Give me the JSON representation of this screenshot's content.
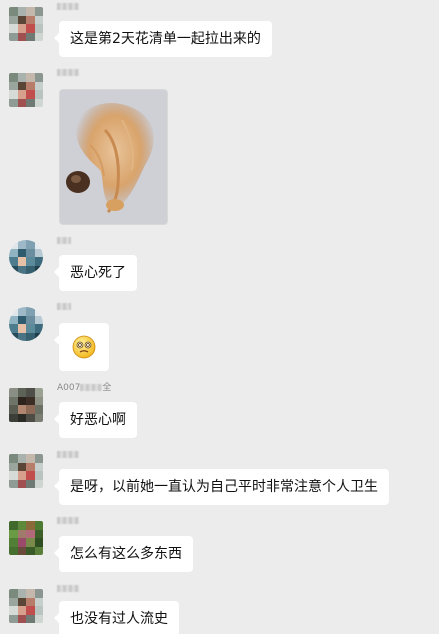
{
  "messages": [
    {
      "id": "m1",
      "sender_visible": "",
      "text": "这是第2天花清单一起拉出来的"
    },
    {
      "id": "m2",
      "sender_visible": "",
      "image_icon": "photo-image"
    },
    {
      "id": "m3",
      "sender_visible": "",
      "text": "恶心死了"
    },
    {
      "id": "m4",
      "sender_visible": "",
      "emoji_icon": "dizzy-face-emoji"
    },
    {
      "id": "m5",
      "sender_prefix": "A007",
      "sender_suffix": "全",
      "text": "好恶心啊"
    },
    {
      "id": "m6",
      "sender_visible": "",
      "text": "是呀，以前她一直认为自己平时非常注意个人卫生"
    },
    {
      "id": "m7",
      "sender_visible": "",
      "text": "怎么有这么多东西"
    },
    {
      "id": "m8",
      "sender_visible": "",
      "text": "也没有过人流史"
    }
  ],
  "colors": {
    "background": "#ececec",
    "bubble": "#ffffff",
    "name_text": "#8a8a8a"
  }
}
